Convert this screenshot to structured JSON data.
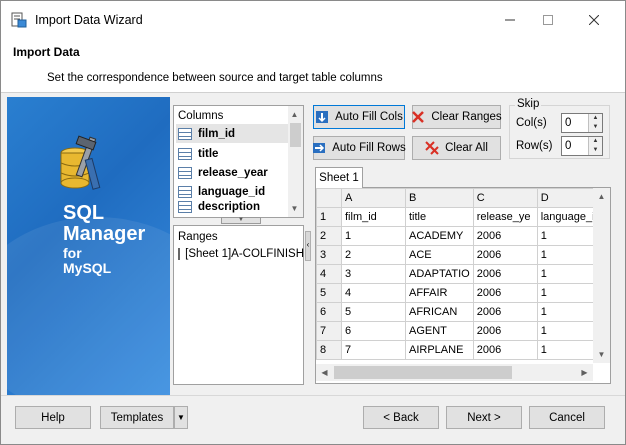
{
  "window": {
    "title": "Import Data Wizard",
    "minimize_icon": "minimize-icon",
    "maximize_icon": "maximize-icon",
    "close_icon": "close-icon"
  },
  "header": {
    "title": "Import Data",
    "subtitle": "Set the correspondence between source and target table columns"
  },
  "banner": {
    "line1": "SQL",
    "line2": "Manager",
    "line3": "for",
    "line4": "MySQL"
  },
  "columns_panel": {
    "header": "Columns",
    "items": [
      "film_id",
      "title",
      "release_year",
      "language_id",
      "description"
    ],
    "selected": "film_id"
  },
  "ranges_panel": {
    "header": "Ranges",
    "items": [
      "[Sheet 1]A-COLFINISH"
    ]
  },
  "toolbar": {
    "auto_fill_cols": "Auto Fill Cols",
    "auto_fill_rows": "Auto Fill Rows",
    "clear_ranges": "Clear Ranges",
    "clear_all": "Clear All"
  },
  "skip": {
    "label": "Skip",
    "cols_label": "Col(s)",
    "cols_value": "0",
    "rows_label": "Row(s)",
    "rows_value": "0"
  },
  "sheet": {
    "tab": "Sheet 1",
    "columns": [
      "A",
      "B",
      "C",
      "D"
    ],
    "rows": [
      [
        "1",
        "film_id",
        "title",
        "release_ye",
        "language_id"
      ],
      [
        "2",
        "1",
        "ACADEMY",
        "2006",
        "1"
      ],
      [
        "3",
        "2",
        "ACE",
        "2006",
        "1"
      ],
      [
        "4",
        "3",
        "ADAPTATIO",
        "2006",
        "1"
      ],
      [
        "5",
        "4",
        "AFFAIR",
        "2006",
        "1"
      ],
      [
        "6",
        "5",
        "AFRICAN",
        "2006",
        "1"
      ],
      [
        "7",
        "6",
        "AGENT",
        "2006",
        "1"
      ],
      [
        "8",
        "7",
        "AIRPLANE",
        "2006",
        "1"
      ]
    ]
  },
  "footer": {
    "help": "Help",
    "templates": "Templates",
    "back": "< Back",
    "next": "Next >",
    "cancel": "Cancel"
  },
  "colors": {
    "banner": "#2a7fd0",
    "accent": "#0078d7"
  }
}
